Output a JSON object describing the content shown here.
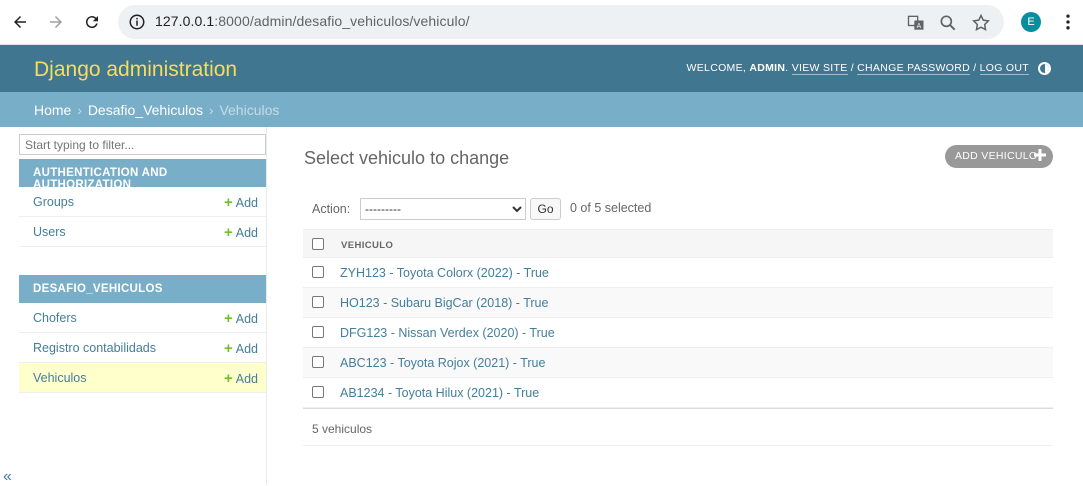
{
  "browser": {
    "url_host": "127.0.0.1",
    "url_path": ":8000/admin/desafio_vehiculos/vehiculo/",
    "profile_initial": "E"
  },
  "header": {
    "brand": "Django administration",
    "welcome": "WELCOME, ",
    "user": "ADMIN",
    "view_site": "VIEW SITE",
    "change_password": "CHANGE PASSWORD",
    "log_out": "LOG OUT",
    "colors": {
      "primary": "#417690",
      "brand_text": "#f5dd5d",
      "secondary": "#79aec8"
    }
  },
  "breadcrumbs": {
    "home": "Home",
    "app": "Desafio_Vehiculos",
    "current": "Vehiculos"
  },
  "sidebar": {
    "filter_placeholder": "Start typing to filter...",
    "modules": [
      {
        "caption": "AUTHENTICATION AND AUTHORIZATION",
        "models": [
          {
            "name": "Groups",
            "add": "Add"
          },
          {
            "name": "Users",
            "add": "Add"
          }
        ]
      },
      {
        "caption": "DESAFIO_VEHICULOS",
        "models": [
          {
            "name": "Chofers",
            "add": "Add"
          },
          {
            "name": "Registro contabilidads",
            "add": "Add"
          },
          {
            "name": "Vehiculos",
            "add": "Add"
          }
        ]
      }
    ],
    "collapse": "«"
  },
  "main": {
    "title": "Select vehiculo to change",
    "add_button": "ADD VEHICULO",
    "action_label": "Action:",
    "action_selected": "---------",
    "go": "Go",
    "selection": "0 of 5 selected",
    "column": "VEHICULO",
    "rows": [
      "ZYH123 - Toyota Colorx (2022) - True",
      "HO123 - Subaru BigCar (2018) - True",
      "DFG123 - Nissan Verdex (2020) - True",
      "ABC123 - Toyota Rojox (2021) - True",
      "AB1234 - Toyota Hilux (2021) - True"
    ],
    "count": "5 vehiculos"
  }
}
